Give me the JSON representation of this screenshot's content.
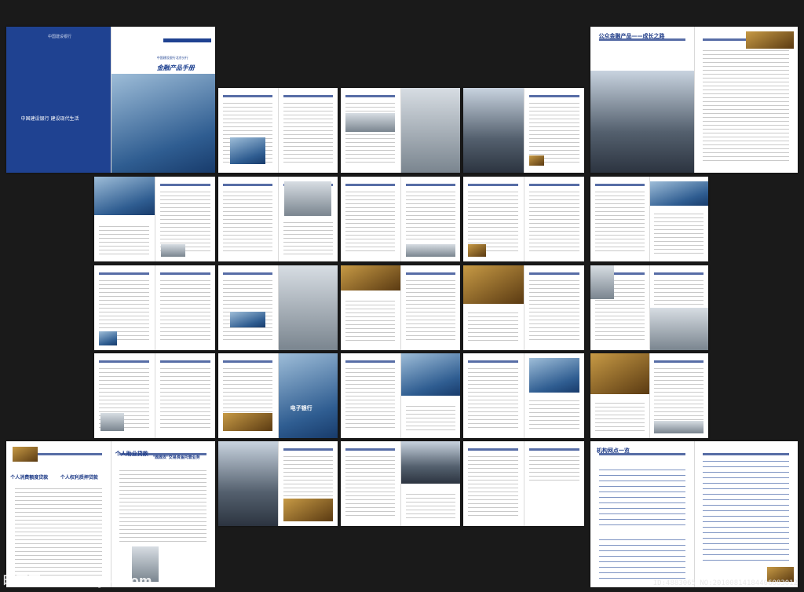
{
  "brochure": {
    "cover_slogan": "中国建设银行  建设现代生活",
    "cover_logo": "中国建设银行",
    "cover_subtitle": "中国建设银行北京分行",
    "cover_title": "金融产品手册",
    "growth_title": "公众金融产品——成长之路",
    "consumer_loan": "个人消费额度贷款",
    "pledge_loan": "个人权利质押贷款",
    "study_loan": "个人助业贷款",
    "safe_deposit": "\"鼎鼎安\"交易资金托管业务",
    "ebank": "电子银行",
    "network_title": "机构网点一览"
  },
  "watermark": {
    "site": "昵图网 www.nipic.com",
    "id": "ID:4883065 NO:20100814184406083012"
  },
  "colors": {
    "accent": "#1f4291",
    "background": "#1a1a1a"
  }
}
